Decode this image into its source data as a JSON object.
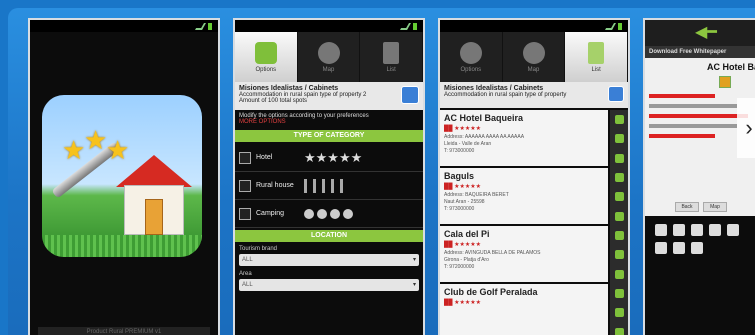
{
  "screens": {
    "splash": {
      "footer_text": "Product Rural PREMIUM v1"
    },
    "search": {
      "tabs": [
        {
          "label": "Options",
          "icon": "gear-icon",
          "active": true
        },
        {
          "label": "Map",
          "icon": "globe-icon",
          "active": false
        },
        {
          "label": "List",
          "icon": "document-icon",
          "active": false
        }
      ],
      "destination_title": "Misiones Idealistas / Cabinets",
      "destination_line1": "Accommodation in rural spain type of property 2",
      "destination_line2": "Amount of 100 total spots",
      "hint_text": "Modify the options according to your preferences",
      "hint_link": "MORE OPTIONS",
      "section_category": "TYPE OF CATEGORY",
      "rows": [
        {
          "label": "Hotel",
          "kind": "stars"
        },
        {
          "label": "Rural house",
          "kind": "bars"
        },
        {
          "label": "Camping",
          "kind": "dots"
        }
      ],
      "stars_glyphs": "★★★★★",
      "section_location": "LOCATION",
      "tourism_label": "Tourism brand",
      "tourism_value": "ALL",
      "area_label": "Area",
      "area_value": "ALL"
    },
    "list": {
      "tabs": [
        {
          "label": "Options",
          "icon": "gear-icon",
          "active": false
        },
        {
          "label": "Map",
          "icon": "globe-icon",
          "active": false
        },
        {
          "label": "List",
          "icon": "document-icon",
          "active": true
        }
      ],
      "destination_title": "Misiones Idealistas / Cabinets",
      "destination_line1": "Accommodation in rural spain type of property",
      "hotels": [
        {
          "name": "AC Hotel Baqueira",
          "stars": "██ ★★★★★",
          "addr1": "Address: AAAAAA AAAA AA AAAAA",
          "addr2": "Lleida - Valle de Aran",
          "addr3": "T: 973000000"
        },
        {
          "name": "Baguls",
          "stars": "██ ★★★★★",
          "addr1": "Address: BAQUEIRA BERET",
          "addr2": "Naut Aran - 25598",
          "addr3": "T: 973000000"
        },
        {
          "name": "Cala del Pi",
          "stars": "██ ★★★★★",
          "addr1": "Address: AVINGUDA BELLA DE PALAMOS",
          "addr2": "Girona - Platja d'Aro",
          "addr3": "T: 972000000"
        },
        {
          "name": "Club de Golf Peralada",
          "stars": "██ ★★★★★",
          "addr1": "",
          "addr2": "",
          "addr3": ""
        }
      ]
    },
    "detail": {
      "download_text": "Download Free Whitepaper",
      "hotel_title": "AC Hotel Ba",
      "btn_back": "Back",
      "btn_map": "Map"
    }
  }
}
